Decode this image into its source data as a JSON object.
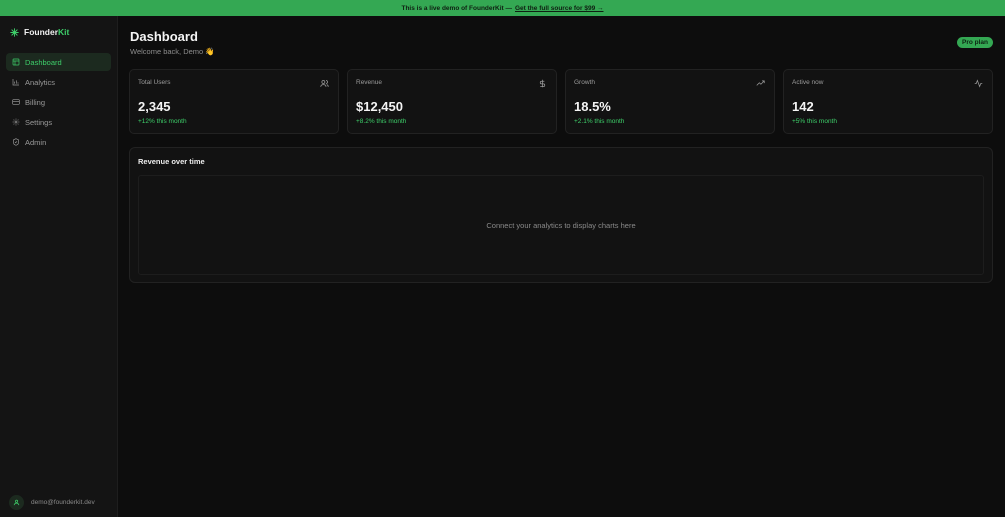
{
  "banner": {
    "text": "This is a live demo of FounderKit —",
    "link": "Get the full source for $99 →"
  },
  "brand": {
    "name_main": "Founder",
    "name_accent": "Kit"
  },
  "sidebar": {
    "items": [
      {
        "label": "Dashboard",
        "icon": "grid-icon",
        "active": true
      },
      {
        "label": "Analytics",
        "icon": "bar-chart-icon",
        "active": false
      },
      {
        "label": "Billing",
        "icon": "credit-card-icon",
        "active": false
      },
      {
        "label": "Settings",
        "icon": "gear-icon",
        "active": false
      },
      {
        "label": "Admin",
        "icon": "shield-icon",
        "active": false
      }
    ],
    "user_email": "demo@founderkit.dev"
  },
  "header": {
    "title": "Dashboard",
    "subtitle": "Welcome back, Demo 👋",
    "plan_badge": "Pro plan"
  },
  "stats": [
    {
      "label": "Total Users",
      "value": "2,345",
      "delta": "+12% this month",
      "icon": "users-icon"
    },
    {
      "label": "Revenue",
      "value": "$12,450",
      "delta": "+8.2% this month",
      "icon": "dollar-icon"
    },
    {
      "label": "Growth",
      "value": "18.5%",
      "delta": "+2.1% this month",
      "icon": "trending-up-icon"
    },
    {
      "label": "Active now",
      "value": "142",
      "delta": "+5% this month",
      "icon": "activity-icon"
    }
  ],
  "chart_panel": {
    "title": "Revenue over time",
    "placeholder": "Connect your analytics to display charts here"
  },
  "colors": {
    "accent": "#3ecf6a",
    "banner": "#34a853",
    "background": "#0d0d0d",
    "sidebar": "#141414"
  }
}
